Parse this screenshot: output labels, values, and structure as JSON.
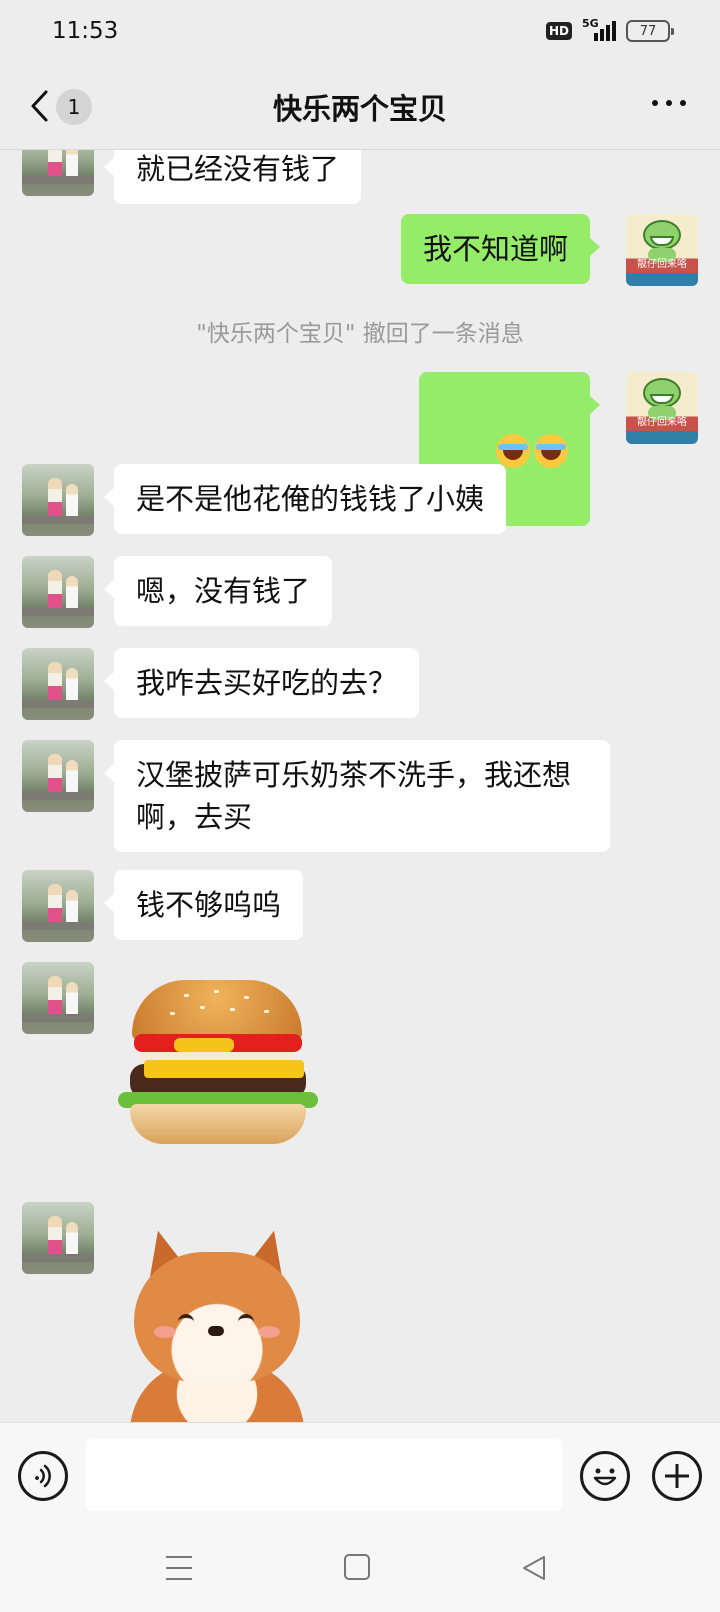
{
  "status_bar": {
    "time": "11:53",
    "hd_label": "HD",
    "network": "5G",
    "battery": "77"
  },
  "header": {
    "unread_count": "1",
    "title": "快乐两个宝贝",
    "back_icon": "chevron-left-icon",
    "more_icon": "more-horizontal-icon"
  },
  "messages": [
    {
      "side": "left",
      "text": "就已经没有钱了"
    },
    {
      "side": "right",
      "text": "我不知道啊"
    },
    {
      "type": "system",
      "text": "\"快乐两个宝贝\" 撤回了一条消息"
    },
    {
      "side": "right",
      "type": "emoji",
      "emoji": [
        "tears-of-joy-emoji",
        "tears-of-joy-emoji"
      ]
    },
    {
      "side": "left",
      "text": "是不是他花俺的钱钱了小姨"
    },
    {
      "side": "left",
      "text": "嗯，没有钱了"
    },
    {
      "side": "left",
      "text": "我咋去买好吃的去？"
    },
    {
      "side": "left",
      "text": "汉堡披萨可乐奶茶不洗手，我还想\n啊，去买"
    },
    {
      "side": "left",
      "text": "钱不够呜呜"
    },
    {
      "side": "left",
      "type": "sticker",
      "sticker": "hamburger-sticker"
    },
    {
      "side": "left",
      "type": "sticker",
      "sticker": "sad-shiba-dog-sticker"
    }
  ],
  "self_avatar_text": "靓仔回来咯",
  "input_bar": {
    "placeholder": "",
    "voice_icon": "voice-icon",
    "emoji_icon": "smiley-icon",
    "plus_icon": "plus-icon"
  },
  "colors": {
    "background": "#ededed",
    "self_bubble": "#95ec69",
    "other_bubble": "#ffffff",
    "system_text": "#9a9a9a"
  }
}
